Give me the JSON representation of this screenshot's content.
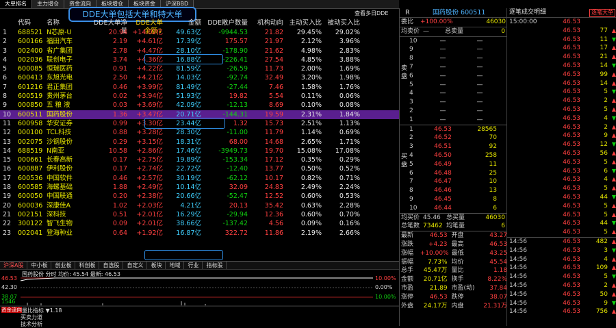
{
  "top_tabs": [
    "大单排名",
    "主力增仓",
    "资金流向",
    "板块增仓",
    "板块资金",
    "沪深BBD"
  ],
  "banner": "DDE大单包括大单和特大单",
  "header": {
    "cols": [
      "代码",
      "名称",
      "DDE大单净量",
      "DDE大单金额↓",
      "金额",
      "DDE散户数量",
      "机构动向",
      "主动买入比",
      "被动买入比"
    ],
    "view_btn": "查看多日DDE"
  },
  "rows": [
    [
      "1",
      "688521",
      "N芯原-U",
      "20.94",
      "+14.02亿",
      "49.63亿",
      "-9944.53",
      "21.82",
      "29.45%",
      "29.02%"
    ],
    [
      "2",
      "600166",
      "福田汽车",
      "2.19",
      "+4.61亿",
      "17.39亿",
      "175.57",
      "21.97",
      "2.12%",
      "3.96%"
    ],
    [
      "3",
      "002400",
      "省广集团",
      "2.78",
      "+4.47亿",
      "28.10亿",
      "-178.90",
      "21.62",
      "4.98%",
      "2.83%"
    ],
    [
      "4",
      "002036",
      "联创电子",
      "3.74",
      "+4.36亿",
      "16.88亿",
      "-226.41",
      "27.54",
      "4.85%",
      "3.88%"
    ],
    [
      "5",
      "600085",
      "恒瑞医药",
      "0.91",
      "+4.22亿",
      "81.59亿",
      "-26.59",
      "11.73",
      "2.00%",
      "1.69%"
    ],
    [
      "6",
      "600413",
      "东旭光电",
      "2.50",
      "+4.21亿",
      "14.03亿",
      "-92.74",
      "32.49",
      "3.20%",
      "1.98%"
    ],
    [
      "7",
      "601216",
      "君正集团",
      "0.46",
      "+3.99亿",
      "81.49亿",
      "-27.44",
      "7.46",
      "1.58%",
      "1.76%"
    ],
    [
      "8",
      "600519",
      "贵州茅台",
      "0.02",
      "+3.94亿",
      "51.93亿",
      "19.82",
      "5.54",
      "0.11%",
      "0.06%"
    ],
    [
      "9",
      "000850",
      "五 粮 液",
      "0.03",
      "+3.69亿",
      "42.09亿",
      "-12.13",
      "8.69",
      "0.10%",
      "0.08%"
    ],
    [
      "10",
      "600511",
      "国药股份",
      "1.36",
      "+3.47亿",
      "20.71亿",
      "-144.31",
      "19.59",
      "2.31%",
      "1.84%"
    ],
    [
      "11",
      "600958",
      "华安证券",
      "0.99",
      "+3.30亿",
      "23.44亿",
      "1.32",
      "15.73",
      "2.51%",
      "1.13%"
    ],
    [
      "12",
      "000100",
      "TCL科技",
      "0.88",
      "+3.28亿",
      "28.30亿",
      "-11.00",
      "11.79",
      "1.14%",
      "0.69%"
    ],
    [
      "13",
      "002075",
      "沙钢股份",
      "0.29",
      "+3.15亿",
      "18.31亿",
      "68.00",
      "14.68",
      "2.65%",
      "1.71%"
    ],
    [
      "14",
      "688519",
      "N南亚",
      "10.58",
      "+2.86亿",
      "17.46亿",
      "-3949.73",
      "19.70",
      "15.08%",
      "17.08%"
    ],
    [
      "15",
      "000661",
      "长春高新",
      "0.17",
      "+2.75亿",
      "19.89亿",
      "-153.34",
      "17.12",
      "0.35%",
      "0.29%"
    ],
    [
      "16",
      "600887",
      "伊利股份",
      "0.17",
      "+2.74亿",
      "22.72亿",
      "-12.40",
      "13.77",
      "0.50%",
      "0.52%"
    ],
    [
      "17",
      "600536",
      "中国软件",
      "0.46",
      "+2.57亿",
      "30.19亿",
      "-62.12",
      "10.17",
      "0.82%",
      "0.71%"
    ],
    [
      "18",
      "600585",
      "海螺基础",
      "1.88",
      "+2.49亿",
      "10.14亿",
      "32.09",
      "24.83",
      "2.49%",
      "2.24%"
    ],
    [
      "19",
      "600050",
      "中国联通",
      "0.20",
      "+2.38亿",
      "20.66亿",
      "-52.47",
      "12.52",
      "0.60%",
      "0.53%"
    ],
    [
      "20",
      "600036",
      "深康佳A",
      "1.02",
      "+2.03亿",
      "4.21亿",
      "20.13",
      "35.42",
      "0.63%",
      "2.28%"
    ],
    [
      "21",
      "002151",
      "深科技",
      "0.51",
      "+2.01亿",
      "16.29亿",
      "-29.94",
      "12.36",
      "0.60%",
      "0.70%"
    ],
    [
      "22",
      "300122",
      "智飞生物",
      "0.09",
      "+2.01亿",
      "38.66亿",
      "-137.42",
      "4.56",
      "0.09%",
      "0.16%"
    ],
    [
      "23",
      "002041",
      "登海种业",
      "0.64",
      "+1.92亿",
      "16.87亿",
      "322.72",
      "11.86",
      "2.19%",
      "2.66%"
    ]
  ],
  "bottom_tabs": [
    "沪深A股",
    "中小板",
    "创业板",
    "科创板",
    "自选股",
    "自定义",
    "板块",
    "地域",
    "行业",
    "指标股"
  ],
  "mini": {
    "title": "国药股份 分时 均价: 45.54 最新: 46.53",
    "y_labels": [
      "46.53",
      "42.30",
      "38.07"
    ],
    "pct_labels": [
      "10.00%",
      "0.00%",
      "10.00%"
    ],
    "vol_label": "1546",
    "ind1": "量比指标 ▼1.18",
    "ind2": "买卖力道",
    "ind3": "技术分析",
    "left_tab": "资金流向"
  },
  "right_panel": {
    "title": "国药股份 600511",
    "r_mark": "R",
    "weibi": [
      "委比",
      "+100.00%",
      "46030"
    ],
    "junmai": [
      "均卖价",
      "—",
      "总卖量",
      "0"
    ],
    "sell_levels": [
      "10",
      "9",
      "8",
      "7",
      "6",
      "5",
      "4",
      "3",
      "2",
      "1"
    ],
    "buy_label": "买 盘",
    "sell_label": "卖 盘",
    "buy_rows": [
      [
        "1",
        "46.53",
        "28565"
      ],
      [
        "2",
        "46.52",
        "70"
      ],
      [
        "3",
        "46.51",
        "92"
      ],
      [
        "4",
        "46.50",
        "258"
      ],
      [
        "5",
        "46.49",
        "11"
      ],
      [
        "6",
        "46.48",
        "25"
      ],
      [
        "7",
        "46.47",
        "10"
      ],
      [
        "8",
        "46.46",
        "13"
      ],
      [
        "9",
        "46.45",
        "8"
      ],
      [
        "10",
        "46.44",
        "6"
      ]
    ],
    "jmj": [
      "均买价",
      "45.46",
      "总买量",
      "46030"
    ],
    "zbs": [
      "总笔数",
      "73462",
      "均笔量",
      "6"
    ],
    "stats": [
      [
        "最新",
        "46.53",
        "开盘",
        "43.27"
      ],
      [
        "涨跌",
        "+4.23",
        "最高",
        "46.53"
      ],
      [
        "涨幅",
        "+10.00%",
        "最低",
        "43.25"
      ],
      [
        "振幅",
        "7.73%",
        "均价",
        "45.54"
      ],
      [
        "总手",
        "45.47万",
        "量比",
        "1.18"
      ],
      [
        "金额",
        "20.71亿",
        "换手",
        "8.22%"
      ],
      [
        "市盈",
        "21.89",
        "市盈(动)",
        "37.84"
      ],
      [
        "涨停",
        "46.53",
        "跌停",
        "38.07"
      ],
      [
        "外盘",
        "24.17万",
        "内盘",
        "21.31万"
      ]
    ]
  },
  "tick_panel": {
    "title": "逐笔成交明细",
    "btn": "逐笔大单",
    "time0": "15:00:00",
    "price0": "46.53",
    "ticks_top": [
      [
        "",
        "46.53",
        "77"
      ],
      [
        "",
        "46.53",
        "11"
      ],
      [
        "",
        "46.53",
        "17"
      ],
      [
        "",
        "46.53",
        "21"
      ],
      [
        "",
        "46.53",
        "14"
      ],
      [
        "",
        "46.53",
        "99"
      ],
      [
        "",
        "46.53",
        "14"
      ],
      [
        "",
        "46.53",
        "5"
      ],
      [
        "",
        "46.53",
        "2"
      ],
      [
        "",
        "46.53",
        "5"
      ],
      [
        "",
        "46.53",
        "4"
      ],
      [
        "",
        "46.53",
        "2"
      ],
      [
        "",
        "46.53",
        "9"
      ],
      [
        "",
        "46.53",
        "12"
      ],
      [
        "",
        "46.53",
        "56"
      ],
      [
        "",
        "46.53",
        "5"
      ],
      [
        "",
        "46.53",
        "6"
      ],
      [
        "",
        "46.53",
        "4"
      ],
      [
        "",
        "46.53",
        "5"
      ],
      [
        "",
        "46.53",
        "44"
      ],
      [
        "",
        "46.53",
        "5"
      ],
      [
        "",
        "46.53",
        "5"
      ],
      [
        "",
        "46.53",
        "44"
      ],
      [
        "",
        "46.53",
        "5"
      ]
    ],
    "ticks_bottom": [
      [
        "14:56",
        "46.53",
        "482"
      ],
      [
        "14:56",
        "46.53",
        "3"
      ],
      [
        "14:56",
        "46.53",
        "4"
      ],
      [
        "14:56",
        "46.53",
        "109"
      ],
      [
        "14:56",
        "46.53",
        "5"
      ],
      [
        "14:56",
        "46.53",
        "2"
      ],
      [
        "14:56",
        "46.53",
        "50"
      ],
      [
        "14:56",
        "46.53",
        "9"
      ],
      [
        "14:56",
        "46.53",
        "756"
      ]
    ]
  }
}
